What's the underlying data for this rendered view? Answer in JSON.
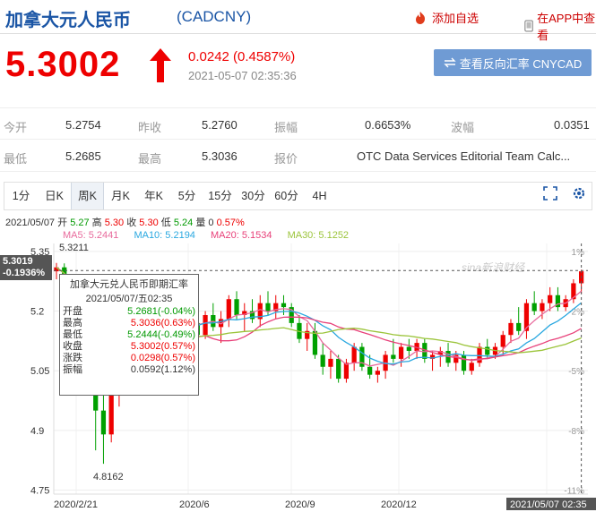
{
  "header": {
    "title": "加拿大元人民币",
    "code": "(CADCNY)",
    "add_watch": "添加自选",
    "view_app": "在APP中查看"
  },
  "quote": {
    "price": "5.3002",
    "change": "0.0242 (0.4587%)",
    "time": "2021-05-07 02:35:36",
    "reverse_button": "查看反向汇率 CNYCAD"
  },
  "stats": {
    "row1": [
      {
        "label": "今开",
        "value": "5.2754"
      },
      {
        "label": "昨收",
        "value": "5.2760"
      },
      {
        "label": "振幅",
        "value": "0.6653%"
      },
      {
        "label": "波幅",
        "value": "0.0351"
      }
    ],
    "row2": [
      {
        "label": "最低",
        "value": "5.2685"
      },
      {
        "label": "最高",
        "value": "5.3036"
      },
      {
        "label": "报价",
        "value": "OTC Data Services Editorial Team Calc..."
      }
    ]
  },
  "tabs": [
    "1分",
    "日K",
    "周K",
    "月K",
    "年K",
    "5分",
    "15分",
    "30分",
    "60分",
    "4H"
  ],
  "active_tab": "周K",
  "info_line": {
    "date": "2021/05/07",
    "open_label": "开",
    "open": "5.27",
    "high_label": "高",
    "high": "5.30",
    "close_label": "收",
    "close": "5.30",
    "low_label": "低",
    "low": "5.24",
    "vol_label": "量",
    "vol": "0",
    "pct": "0.57%"
  },
  "ma": [
    {
      "label": "MA5: 5.2441",
      "color": "#e86a9c"
    },
    {
      "label": "MA10: 5.2194",
      "color": "#2aa8e0"
    },
    {
      "label": "MA20: 5.1534",
      "color": "#e8417a"
    },
    {
      "label": "MA30: 5.1252",
      "color": "#9bc43a"
    }
  ],
  "cursor_badge": {
    "price": "5.3019",
    "pct": "-0.1936%"
  },
  "tooltip": {
    "title": "加拿大元兑人民币即期汇率",
    "date": "2021/05/07/五02:35",
    "rows": [
      {
        "k": "开盘",
        "v": "5.2681(-0.04%)",
        "c": "dn"
      },
      {
        "k": "最高",
        "v": "5.3036(0.63%)",
        "c": "up"
      },
      {
        "k": "最低",
        "v": "5.2444(-0.49%)",
        "c": "dn"
      },
      {
        "k": "收盘",
        "v": "5.3002(0.57%)",
        "c": "up"
      },
      {
        "k": "涨跌",
        "v": "0.0298(0.57%)",
        "c": "up"
      },
      {
        "k": "振幅",
        "v": "0.0592(1.12%)",
        "c": "n"
      }
    ]
  },
  "watermark": "sina新浪财经",
  "chart_data": {
    "type": "candlestick",
    "y_ticks": [
      "5.35",
      "5.2",
      "5.05",
      "4.9",
      "4.75"
    ],
    "y_tick_values": [
      5.35,
      5.2,
      5.05,
      4.9,
      4.75
    ],
    "pct_ticks": [
      "1%",
      "-2%",
      "-5%",
      "-8%",
      "-11%"
    ],
    "x_ticks": [
      "2020/2/21",
      "2020/6",
      "2020/9",
      "2020/12",
      "2021/05/07 02:35"
    ],
    "ylim": [
      4.74,
      5.37
    ],
    "max_label": "5.3211",
    "min_label": "4.8162",
    "candles": [
      [
        5.3,
        5.321,
        5.28,
        5.31
      ],
      [
        5.31,
        5.32,
        5.27,
        5.28
      ],
      [
        5.28,
        5.29,
        5.22,
        5.23
      ],
      [
        5.23,
        5.25,
        5.14,
        5.15
      ],
      [
        5.15,
        5.17,
        5.02,
        5.04
      ],
      [
        5.04,
        5.08,
        4.85,
        4.95
      ],
      [
        4.95,
        5.02,
        4.8162,
        4.89
      ],
      [
        4.89,
        5.03,
        4.87,
        5.01
      ],
      [
        5.01,
        5.09,
        4.96,
        5.07
      ],
      [
        5.07,
        5.15,
        5.03,
        5.13
      ],
      [
        5.13,
        5.19,
        5.1,
        5.16
      ],
      [
        5.16,
        5.22,
        5.12,
        5.14
      ],
      [
        5.14,
        5.2,
        5.1,
        5.18
      ],
      [
        5.18,
        5.22,
        5.14,
        5.2
      ],
      [
        5.2,
        5.23,
        5.15,
        5.17
      ],
      [
        5.17,
        5.2,
        5.12,
        5.14
      ],
      [
        5.14,
        5.23,
        5.12,
        5.21
      ],
      [
        5.21,
        5.25,
        5.16,
        5.17
      ],
      [
        5.17,
        5.19,
        5.12,
        5.14
      ],
      [
        5.14,
        5.2,
        5.13,
        5.19
      ],
      [
        5.19,
        5.22,
        5.15,
        5.16
      ],
      [
        5.16,
        5.2,
        5.12,
        5.18
      ],
      [
        5.18,
        5.24,
        5.16,
        5.23
      ],
      [
        5.23,
        5.25,
        5.18,
        5.19
      ],
      [
        5.19,
        5.22,
        5.15,
        5.2
      ],
      [
        5.2,
        5.23,
        5.17,
        5.18
      ],
      [
        5.18,
        5.24,
        5.16,
        5.22
      ],
      [
        5.22,
        5.25,
        5.19,
        5.2
      ],
      [
        5.2,
        5.24,
        5.18,
        5.22
      ],
      [
        5.22,
        5.24,
        5.19,
        5.21
      ],
      [
        5.21,
        5.22,
        5.16,
        5.17
      ],
      [
        5.17,
        5.19,
        5.12,
        5.13
      ],
      [
        5.13,
        5.17,
        5.1,
        5.15
      ],
      [
        5.15,
        5.17,
        5.08,
        5.09
      ],
      [
        5.09,
        5.12,
        5.04,
        5.06
      ],
      [
        5.06,
        5.1,
        5.03,
        5.08
      ],
      [
        5.08,
        5.09,
        5.02,
        5.03
      ],
      [
        5.03,
        5.08,
        5.02,
        5.07
      ],
      [
        5.07,
        5.12,
        5.05,
        5.11
      ],
      [
        5.11,
        5.12,
        5.05,
        5.06
      ],
      [
        5.06,
        5.09,
        5.03,
        5.04
      ],
      [
        5.04,
        5.06,
        5.02,
        5.05
      ],
      [
        5.05,
        5.1,
        5.03,
        5.09
      ],
      [
        5.09,
        5.13,
        5.07,
        5.08
      ],
      [
        5.08,
        5.12,
        5.06,
        5.11
      ],
      [
        5.11,
        5.13,
        5.08,
        5.1
      ],
      [
        5.1,
        5.13,
        5.08,
        5.12
      ],
      [
        5.12,
        5.13,
        5.07,
        5.08
      ],
      [
        5.08,
        5.1,
        5.05,
        5.09
      ],
      [
        5.09,
        5.11,
        5.06,
        5.1
      ],
      [
        5.1,
        5.12,
        5.06,
        5.07
      ],
      [
        5.07,
        5.1,
        5.05,
        5.09
      ],
      [
        5.09,
        5.1,
        5.04,
        5.05
      ],
      [
        5.05,
        5.08,
        5.04,
        5.07
      ],
      [
        5.07,
        5.12,
        5.06,
        5.11
      ],
      [
        5.11,
        5.13,
        5.08,
        5.09
      ],
      [
        5.09,
        5.12,
        5.08,
        5.11
      ],
      [
        5.11,
        5.15,
        5.09,
        5.14
      ],
      [
        5.14,
        5.18,
        5.12,
        5.17
      ],
      [
        5.17,
        5.21,
        5.14,
        5.15
      ],
      [
        5.15,
        5.23,
        5.13,
        5.22
      ],
      [
        5.22,
        5.25,
        5.19,
        5.2
      ],
      [
        5.2,
        5.23,
        5.18,
        5.22
      ],
      [
        5.22,
        5.26,
        5.2,
        5.24
      ],
      [
        5.24,
        5.26,
        5.2,
        5.21
      ],
      [
        5.21,
        5.24,
        5.2,
        5.23
      ],
      [
        5.23,
        5.28,
        5.22,
        5.27
      ],
      [
        5.27,
        5.304,
        5.244,
        5.3
      ]
    ]
  }
}
